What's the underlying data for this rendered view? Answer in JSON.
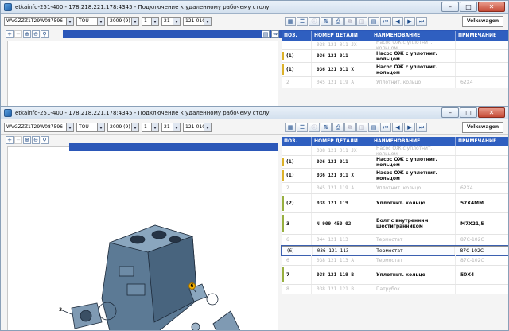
{
  "colors": {
    "accent": "#2f5fc0",
    "marker_yellow": "#dcb22a",
    "marker_green": "#98b040"
  },
  "back_window": {
    "title": "etkainfo-251-400 - 178.218.221.178:4345 - Подключение к удаленному рабочему столу",
    "toolbar": {
      "vin": "WVGZZZ1T29W087596",
      "model": "TOU",
      "date": "2009 (9)",
      "main_group": "1",
      "sub_group": "21",
      "illustration": "121-010",
      "brand": "Volkswagen"
    },
    "headers": {
      "pos": "ПОЗ.",
      "part": "НОМЕР ДЕТАЛИ",
      "name": "НАИМЕНОВАНИЕ",
      "note": "ПРИМЕЧАНИЕ"
    },
    "rows": [
      {
        "pos": "",
        "part": "038 121 011 JX",
        "name": "Насос ОЖ с уплотнит. кольцом",
        "note": "",
        "state": "dim",
        "mark": "",
        "h": 12
      },
      {
        "pos": "(1)",
        "part": "036 121 011",
        "name": "Насос ОЖ с уплотнит. кольцом",
        "note": "",
        "state": "bold",
        "mark": "yellow",
        "h": 16
      },
      {
        "pos": "(1)",
        "part": "036 121 011  X",
        "name": "Насос ОЖ с уплотнит. кольцом",
        "note": "",
        "state": "bold",
        "mark": "yellow",
        "h": 18
      },
      {
        "pos": "2",
        "part": "045 121 119 A",
        "name": "Уплотнит. кольцо",
        "note": "62X4",
        "state": "dim",
        "mark": "",
        "h": 14
      }
    ]
  },
  "front_window": {
    "title": "etkainfo-251-400 - 178.218.221.178:4345 - Подключение к удаленному рабочему столу",
    "toolbar": {
      "vin": "WVGZZZ1T29W087596",
      "model": "TOU",
      "date": "2009 (9)",
      "main_group": "1",
      "sub_group": "21",
      "illustration": "121-010",
      "brand": "Volkswagen"
    },
    "headers": {
      "pos": "ПОЗ.",
      "part": "НОМЕР ДЕТАЛИ",
      "name": "НАИМЕНОВАНИЕ",
      "note": "ПРИМЕЧАНИЕ"
    },
    "rows": [
      {
        "pos": "",
        "part": "038 121 011 JX",
        "name": "Насос ОЖ с уплотнит. кольцом",
        "note": "",
        "state": "dim",
        "mark": "",
        "h": 12
      },
      {
        "pos": "(1)",
        "part": "036 121 011",
        "name": "Насос ОЖ с уплотнит. кольцом",
        "note": "",
        "state": "bold",
        "mark": "yellow",
        "h": 16
      },
      {
        "pos": "(1)",
        "part": "036 121 011  X",
        "name": "Насос ОЖ с уплотнит. кольцом",
        "note": "",
        "state": "bold",
        "mark": "yellow",
        "h": 18
      },
      {
        "pos": "2",
        "part": "045 121 119 A",
        "name": "Уплотнит. кольцо",
        "note": "62X4",
        "state": "dim",
        "mark": "",
        "h": 14
      },
      {
        "pos": "(2)",
        "part": "038 121 119",
        "name": "Уплотнит. кольцо",
        "note": "57X4MM",
        "state": "bold",
        "mark": "green",
        "h": 24
      },
      {
        "pos": "3",
        "part": "N   909 450 02",
        "name": "Болт с внутренним шестигранником",
        "note": "M7X21,5",
        "state": "bold",
        "mark": "green",
        "h": 27
      },
      {
        "pos": "6",
        "part": "044 121 113",
        "name": "Термостат",
        "note": "87C-102C",
        "state": "dim",
        "mark": "",
        "h": 14
      },
      {
        "pos": "(6)",
        "part": "036 121 113",
        "name": "Термостат",
        "note": "87C-102C",
        "state": "sel",
        "mark": "",
        "h": 12
      },
      {
        "pos": "6",
        "part": "038 121 113 A",
        "name": "Термостат",
        "note": "87C-102C",
        "state": "dim",
        "mark": "",
        "h": 13
      },
      {
        "pos": "7",
        "part": "038 121 119 B",
        "name": "Уплотнит. кольцо",
        "note": "50X4",
        "state": "bold",
        "mark": "green",
        "h": 24
      },
      {
        "pos": "8",
        "part": "038 121 121 B",
        "name": "Патрубок",
        "note": "",
        "state": "dim",
        "mark": "",
        "h": 12
      }
    ],
    "callouts": {
      "c3": "3",
      "c6": "6"
    }
  }
}
